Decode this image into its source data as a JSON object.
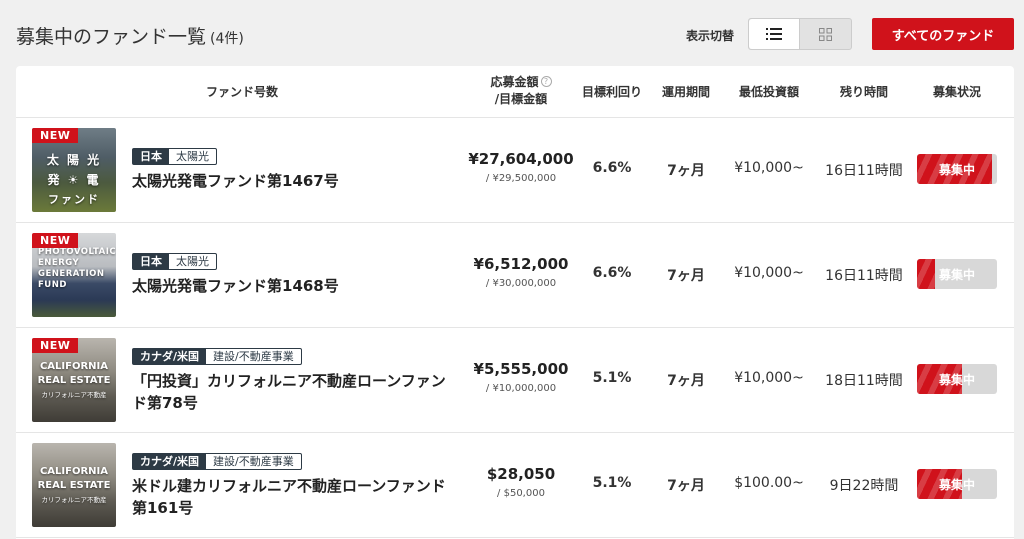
{
  "header": {
    "title": "募集中のファンド一覧",
    "count": "(4件)",
    "view_toggle_label": "表示切替",
    "all_funds_button": "すべてのファンド"
  },
  "table": {
    "columns": {
      "fund": "ファンド号数",
      "amount_line1": "応募金額",
      "amount_line2": "/目標金額",
      "yield": "目標利回り",
      "period": "運用期間",
      "min_investment": "最低投資額",
      "remaining": "残り時間",
      "status": "募集状況"
    },
    "rows": [
      {
        "badge": "NEW",
        "thumb_lines": [
          "太 陽 光",
          "発 ☀ 電",
          "ファンド"
        ],
        "tag_region": "日本",
        "tag_category": "太陽光",
        "name": "太陽光発電ファンド第1467号",
        "raised": "¥27,604,000",
        "target": "/ ¥29,500,000",
        "yield": "6.6%",
        "period": "7ヶ月",
        "min_investment": "¥10,000~",
        "remaining": "16日11時間",
        "status": "募集中",
        "progress": 0.94
      },
      {
        "badge": "NEW",
        "thumb_lines": [
          "PHOTOVOLTAIC",
          "ENERGY",
          "GENERATION",
          "FUND"
        ],
        "tag_region": "日本",
        "tag_category": "太陽光",
        "name": "太陽光発電ファンド第1468号",
        "raised": "¥6,512,000",
        "target": "/ ¥30,000,000",
        "yield": "6.6%",
        "period": "7ヶ月",
        "min_investment": "¥10,000~",
        "remaining": "16日11時間",
        "status": "募集中",
        "progress": 0.22
      },
      {
        "badge": "NEW",
        "thumb_lines": [
          "CALIFORNIA",
          "REAL ESTATE",
          "カリフォルニア不動産"
        ],
        "tag_region": "カナダ/米国",
        "tag_category": "建設/不動産事業",
        "name": "「円投資」カリフォルニア不動産ローンファンド第78号",
        "raised": "¥5,555,000",
        "target": "/ ¥10,000,000",
        "yield": "5.1%",
        "period": "7ヶ月",
        "min_investment": "¥10,000~",
        "remaining": "18日11時間",
        "status": "募集中",
        "progress": 0.56
      },
      {
        "badge": "",
        "thumb_lines": [
          "CALIFORNIA",
          "REAL ESTATE",
          "カリフォルニア不動産"
        ],
        "tag_region": "カナダ/米国",
        "tag_category": "建設/不動産事業",
        "name": "米ドル建カリフォルニア不動産ローンファンド第161号",
        "raised": "$28,050",
        "target": "/ $50,000",
        "yield": "5.1%",
        "period": "7ヶ月",
        "min_investment": "$100.00~",
        "remaining": "9日22時間",
        "status": "募集中",
        "progress": 0.56
      }
    ]
  },
  "colors": {
    "accent": "#d0121b",
    "tag_dark": "#2d3a45",
    "status_track": "#d8d8d8"
  },
  "icons": {
    "list_view": "list-icon",
    "grid_view": "grid-icon",
    "help": "question-circle-icon"
  }
}
